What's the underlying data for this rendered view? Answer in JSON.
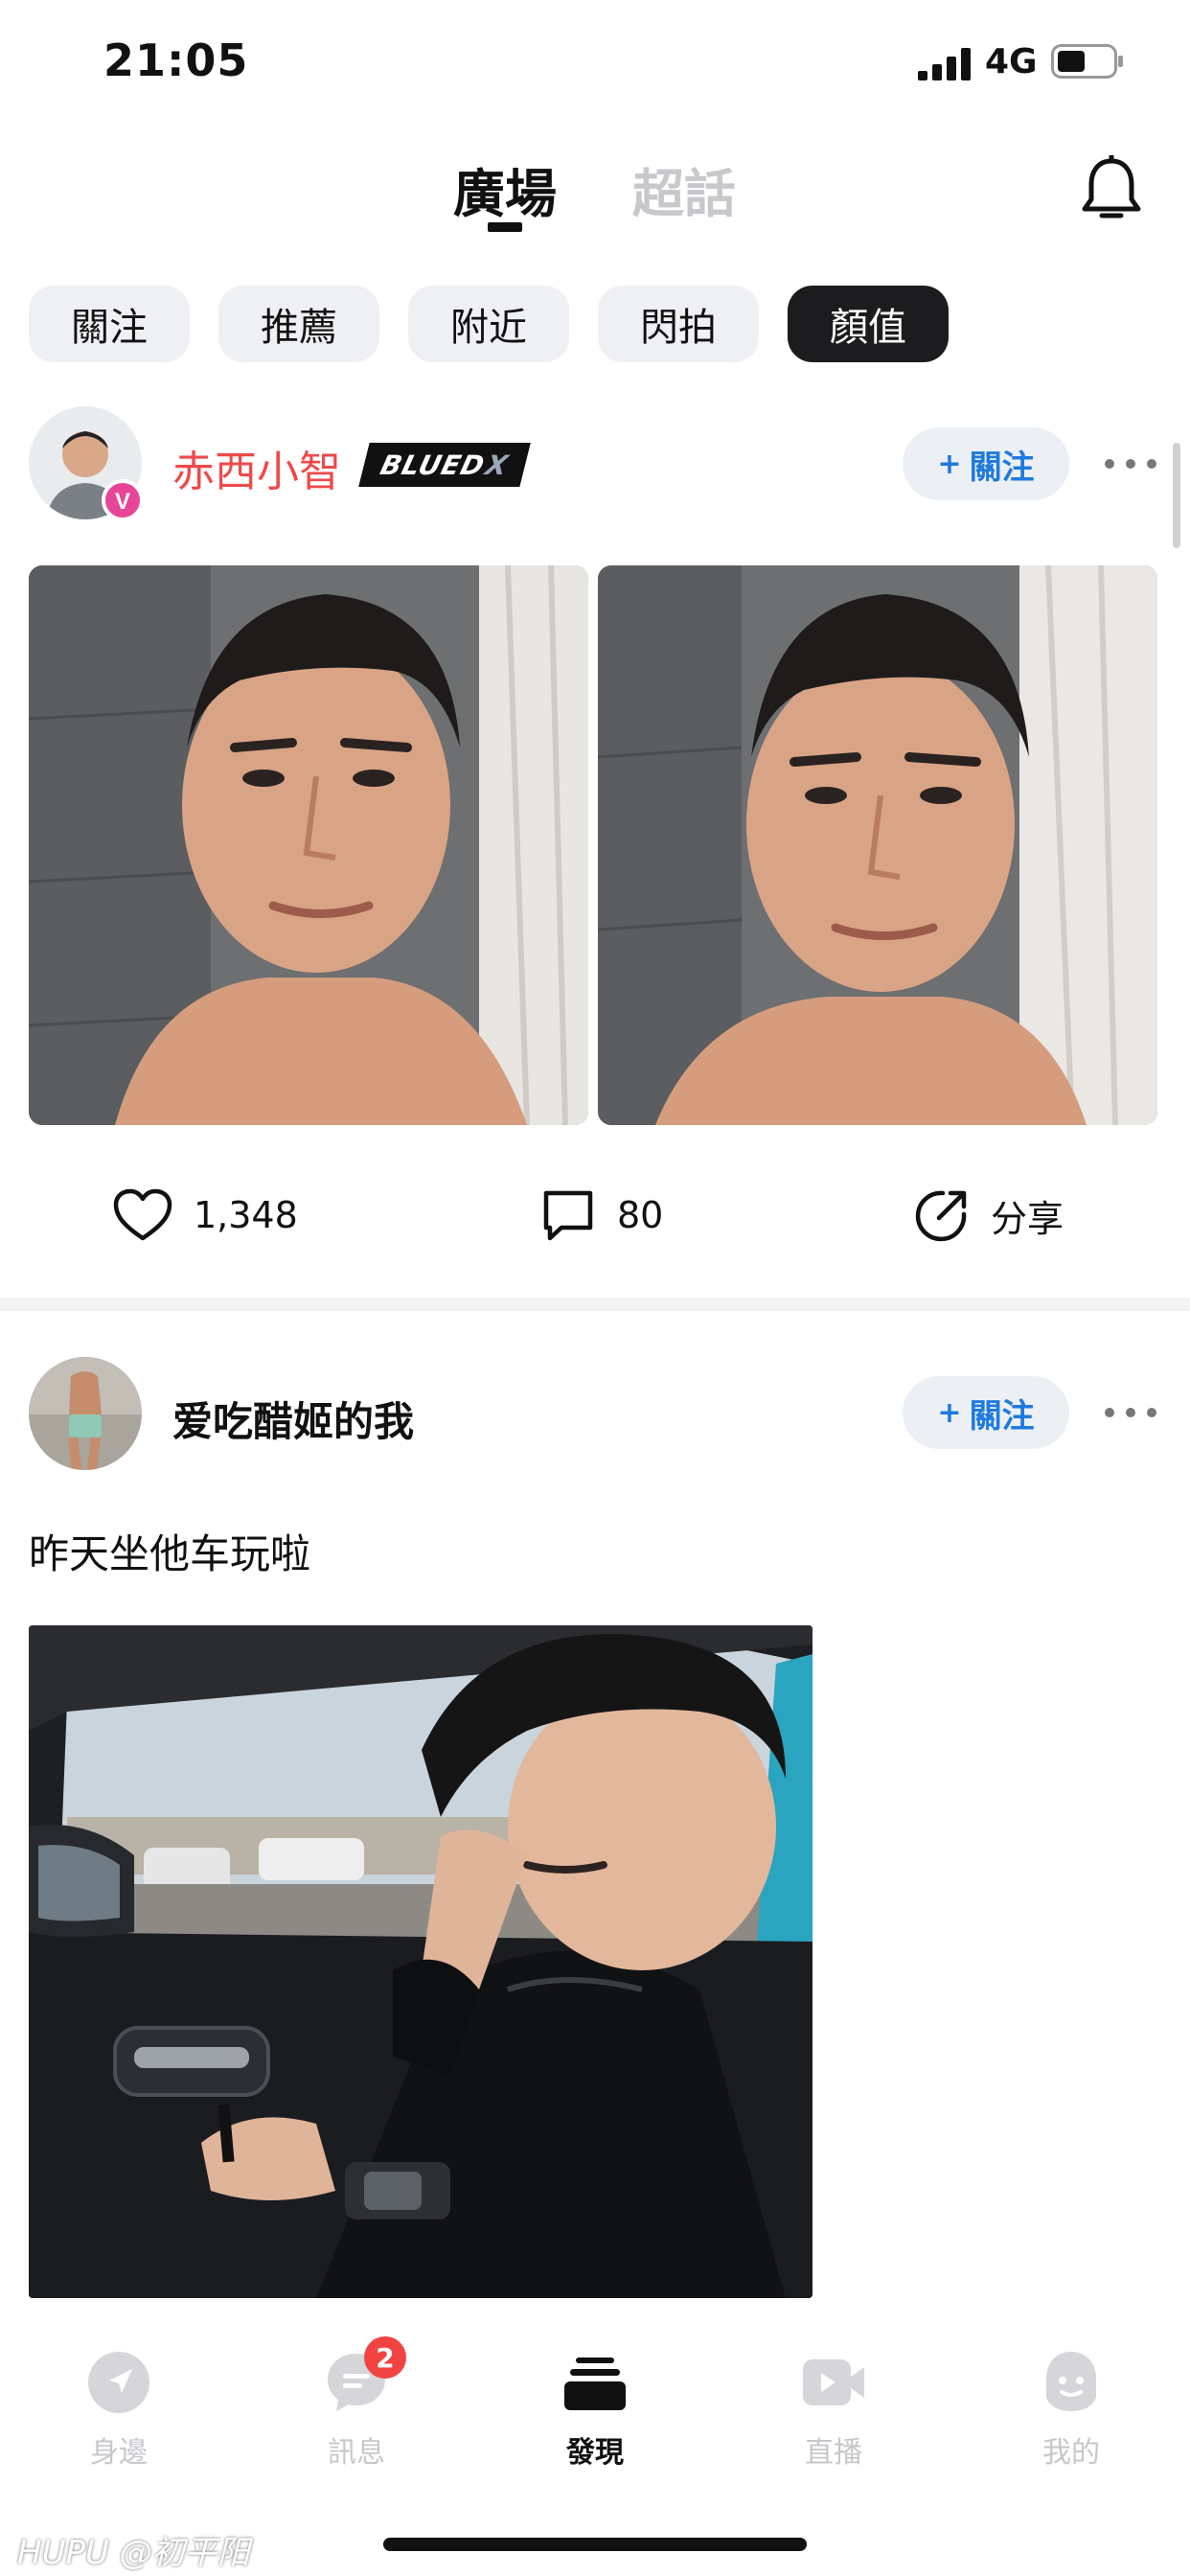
{
  "status_bar": {
    "time": "21:05",
    "network": "4G"
  },
  "header": {
    "tabs": [
      {
        "label": "廣場",
        "active": true
      },
      {
        "label": "超話",
        "active": false
      }
    ],
    "icon": "bell-icon"
  },
  "filters": [
    {
      "label": "關注",
      "active": false
    },
    {
      "label": "推薦",
      "active": false
    },
    {
      "label": "附近",
      "active": false
    },
    {
      "label": "閃拍",
      "active": false
    },
    {
      "label": "顏值",
      "active": true
    }
  ],
  "posts": [
    {
      "username": "赤西小智",
      "badge": {
        "main": "BLUED",
        "suffix": "X"
      },
      "verified_mark": "V",
      "follow_label": "關注",
      "likes": "1,348",
      "comments": "80",
      "share_label": "分享"
    },
    {
      "username": "爱吃醋姬的我",
      "follow_label": "關注",
      "text": "昨天坐他车玩啦"
    }
  ],
  "bottom_nav": [
    {
      "label": "身邊",
      "icon": "location-arrow-icon",
      "active": false
    },
    {
      "label": "訊息",
      "icon": "chat-bubble-icon",
      "active": false,
      "badge": "2"
    },
    {
      "label": "發現",
      "icon": "stack-icon",
      "active": true
    },
    {
      "label": "直播",
      "icon": "video-play-icon",
      "active": false
    },
    {
      "label": "我的",
      "icon": "profile-icon",
      "active": false
    }
  ],
  "watermark": "HUPU @初平阳",
  "colors": {
    "accent_blue": "#1f7ae0",
    "username_red": "#ee4a4a",
    "chip_active": "#1c1c1e",
    "badge_red": "#f24343"
  }
}
